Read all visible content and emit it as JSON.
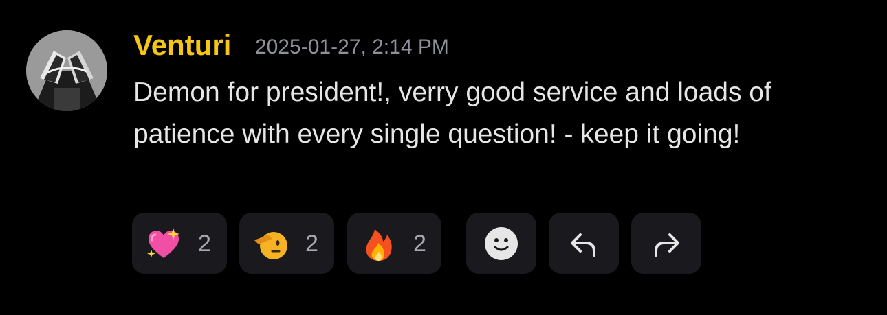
{
  "message": {
    "author": "Venturi",
    "timestamp": "2025-01-27, 2:14 PM",
    "content": "Demon for president!, verry good service and loads of patience with every single question! - keep it going!",
    "author_color": "#f5c518"
  },
  "reactions": [
    {
      "icon": "sparkling-heart-icon",
      "count": "2"
    },
    {
      "icon": "saluting-face-icon",
      "count": "2"
    },
    {
      "icon": "fire-icon",
      "count": "2"
    }
  ],
  "actions": [
    {
      "icon": "add-reaction-icon"
    },
    {
      "icon": "reply-icon"
    },
    {
      "icon": "forward-icon"
    }
  ],
  "colors": {
    "background": "#000000",
    "chip": "#1a1a1e",
    "text": "#e6e6e6",
    "muted": "#8f9199"
  }
}
